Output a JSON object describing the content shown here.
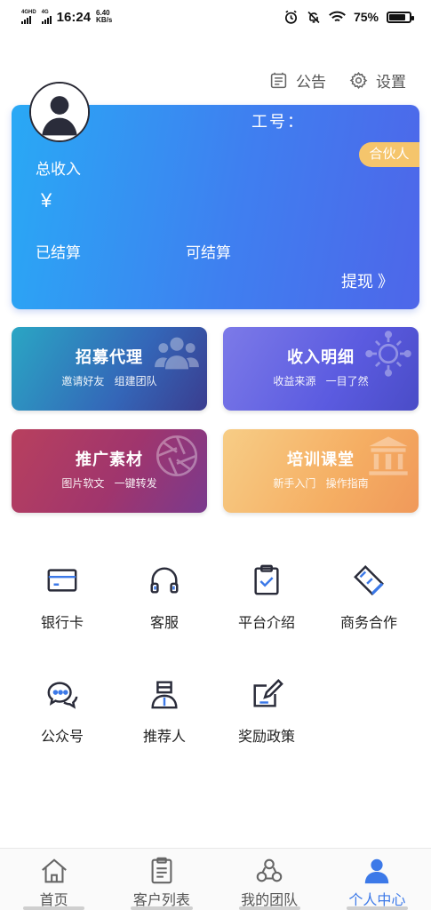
{
  "status_bar": {
    "signal1": "4GHD",
    "signal2": "4G",
    "time": "16:24",
    "speed_value": "6.40",
    "speed_unit": "KB/s",
    "battery": "75%"
  },
  "top_actions": {
    "announcement": "公告",
    "settings": "设置"
  },
  "profile_card": {
    "employee_no_label": "工号：",
    "partner_badge": "合伙人",
    "total_income_label": "总收入",
    "currency_symbol": "¥",
    "settled_label": "已结算",
    "settleable_label": "可结算",
    "withdraw_label": "提现 》"
  },
  "features": [
    {
      "title": "招募代理",
      "subtitle": "邀请好友 组建团队"
    },
    {
      "title": "收入明细",
      "subtitle": "收益来源 一目了然"
    },
    {
      "title": "推广素材",
      "subtitle": "图片软文 一键转发"
    },
    {
      "title": "培训课堂",
      "subtitle": "新手入门 操作指南"
    }
  ],
  "services": [
    {
      "label": "银行卡",
      "icon": "bank-card-icon"
    },
    {
      "label": "客服",
      "icon": "headset-icon"
    },
    {
      "label": "平台介绍",
      "icon": "clipboard-check-icon"
    },
    {
      "label": "商务合作",
      "icon": "handshake-icon"
    },
    {
      "label": "公众号",
      "icon": "chat-bubbles-icon"
    },
    {
      "label": "推荐人",
      "icon": "person-icon"
    },
    {
      "label": "奖励政策",
      "icon": "edit-icon"
    }
  ],
  "bottom_nav": [
    {
      "label": "首页",
      "icon": "home-icon"
    },
    {
      "label": "客户列表",
      "icon": "list-icon"
    },
    {
      "label": "我的团队",
      "icon": "team-icon"
    },
    {
      "label": "个人中心",
      "icon": "user-icon"
    }
  ],
  "colors": {
    "card_gradient_start": "#29a9f5",
    "card_gradient_end": "#4e66e9",
    "badge": "#f5c56c",
    "active_nav": "#3c79e8"
  }
}
